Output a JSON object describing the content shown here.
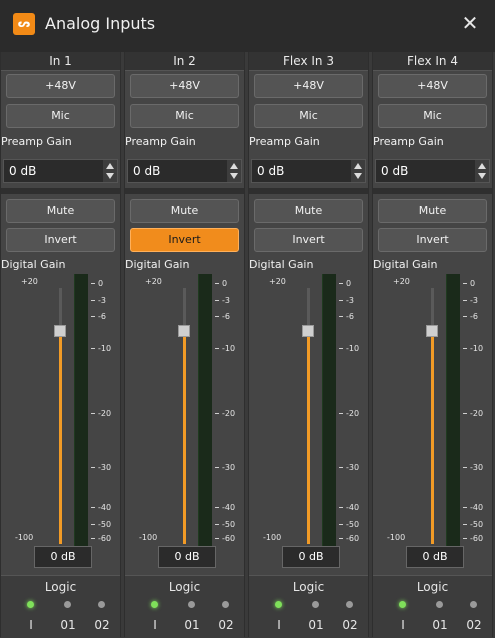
{
  "window": {
    "title": "Analog Inputs",
    "icon_text": "ᔕ"
  },
  "colors": {
    "accent": "#f18c1c",
    "led_on": "#7fe05a"
  },
  "strips": [
    {
      "name": "In 1",
      "phantom": "+48V",
      "mic": "Mic",
      "preamp_label": "Preamp Gain",
      "preamp_value": "0 dB",
      "mute": "Mute",
      "invert": "Invert",
      "invert_active": false,
      "digital_gain_label": "Digital Gain",
      "gain_top": "+20",
      "gain_bottom": "-100",
      "gain_value": "0 dB",
      "gain_level_db": 0,
      "logic_label": "Logic",
      "logic_leds": [
        {
          "label": "I",
          "on": true
        },
        {
          "label": "01",
          "on": false
        },
        {
          "label": "02",
          "on": false
        }
      ]
    },
    {
      "name": "In 2",
      "phantom": "+48V",
      "mic": "Mic",
      "preamp_label": "Preamp Gain",
      "preamp_value": "0 dB",
      "mute": "Mute",
      "invert": "Invert",
      "invert_active": true,
      "digital_gain_label": "Digital Gain",
      "gain_top": "+20",
      "gain_bottom": "-100",
      "gain_value": "0 dB",
      "gain_level_db": 0,
      "logic_label": "Logic",
      "logic_leds": [
        {
          "label": "I",
          "on": true
        },
        {
          "label": "01",
          "on": false
        },
        {
          "label": "02",
          "on": false
        }
      ]
    },
    {
      "name": "Flex In 3",
      "phantom": "+48V",
      "mic": "Mic",
      "preamp_label": "Preamp Gain",
      "preamp_value": "0 dB",
      "mute": "Mute",
      "invert": "Invert",
      "invert_active": false,
      "digital_gain_label": "Digital Gain",
      "gain_top": "+20",
      "gain_bottom": "-100",
      "gain_value": "0 dB",
      "gain_level_db": 0,
      "logic_label": "Logic",
      "logic_leds": [
        {
          "label": "I",
          "on": true
        },
        {
          "label": "01",
          "on": false
        },
        {
          "label": "02",
          "on": false
        }
      ]
    },
    {
      "name": "Flex In 4",
      "phantom": "+48V",
      "mic": "Mic",
      "preamp_label": "Preamp Gain",
      "preamp_value": "0 dB",
      "mute": "Mute",
      "invert": "Invert",
      "invert_active": false,
      "digital_gain_label": "Digital Gain",
      "gain_top": "+20",
      "gain_bottom": "-100",
      "gain_value": "0 dB",
      "gain_level_db": 0,
      "logic_label": "Logic",
      "logic_leds": [
        {
          "label": "I",
          "on": true
        },
        {
          "label": "01",
          "on": false
        },
        {
          "label": "02",
          "on": false
        }
      ]
    }
  ],
  "meter_scale": [
    "0",
    "-3",
    "-6",
    "-10",
    "-20",
    "-30",
    "-40",
    "-50",
    "-60"
  ]
}
